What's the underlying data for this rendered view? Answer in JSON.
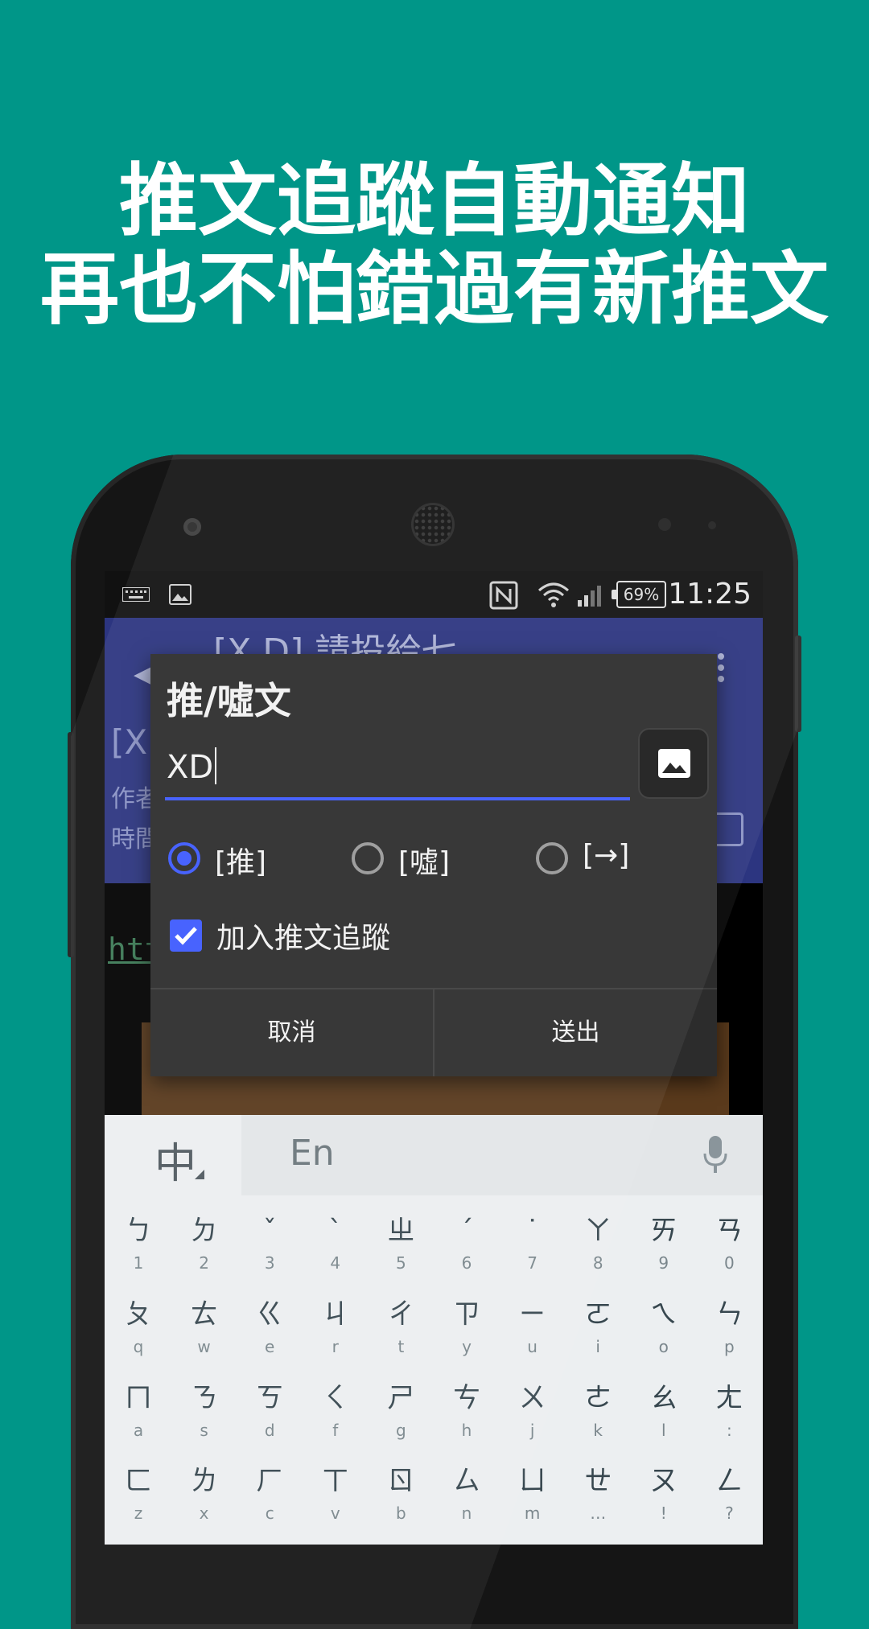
{
  "headline": {
    "line1": "推文追蹤自動通知",
    "line2": "再也不怕錯過有新推文"
  },
  "status_bar": {
    "battery": "69%",
    "time": "11:25",
    "icons": [
      "keyboard-icon",
      "image-icon",
      "nfc-icon",
      "wifi-icon",
      "signal-icon",
      "battery-icon"
    ]
  },
  "app_bar": {
    "title": "[X D] 請投給七"
  },
  "article": {
    "title_partial": "[X",
    "author_partial": "作者",
    "time_partial": "時間",
    "link_partial": "htt"
  },
  "dialog": {
    "title": "推/噓文",
    "input_value": "XD",
    "options": [
      {
        "label": "[推]",
        "selected": true
      },
      {
        "label": "[噓]",
        "selected": false
      },
      {
        "label": "[→]",
        "selected": false
      }
    ],
    "track_checkbox_label": "加入推文追蹤",
    "track_checked": true,
    "cancel_label": "取消",
    "send_label": "送出",
    "accent_color": "#3d5afe"
  },
  "keyboard": {
    "lang_label": "中",
    "en_label": "En",
    "rows": [
      [
        {
          "main": "ㄅ",
          "sub": "1"
        },
        {
          "main": "ㄉ",
          "sub": "2"
        },
        {
          "main": "ˇ",
          "sub": "3"
        },
        {
          "main": "ˋ",
          "sub": "4"
        },
        {
          "main": "ㄓ",
          "sub": "5"
        },
        {
          "main": "ˊ",
          "sub": "6"
        },
        {
          "main": "˙",
          "sub": "7"
        },
        {
          "main": "ㄚ",
          "sub": "8"
        },
        {
          "main": "ㄞ",
          "sub": "9"
        },
        {
          "main": "ㄢ",
          "sub": "0"
        }
      ],
      [
        {
          "main": "ㄆ",
          "sub": "q"
        },
        {
          "main": "ㄊ",
          "sub": "w"
        },
        {
          "main": "ㄍ",
          "sub": "e"
        },
        {
          "main": "ㄐ",
          "sub": "r"
        },
        {
          "main": "ㄔ",
          "sub": "t"
        },
        {
          "main": "ㄗ",
          "sub": "y"
        },
        {
          "main": "ㄧ",
          "sub": "u"
        },
        {
          "main": "ㄛ",
          "sub": "i"
        },
        {
          "main": "ㄟ",
          "sub": "o"
        },
        {
          "main": "ㄣ",
          "sub": "p"
        }
      ],
      [
        {
          "main": "ㄇ",
          "sub": "a"
        },
        {
          "main": "ㄋ",
          "sub": "s"
        },
        {
          "main": "ㄎ",
          "sub": "d"
        },
        {
          "main": "ㄑ",
          "sub": "f"
        },
        {
          "main": "ㄕ",
          "sub": "g"
        },
        {
          "main": "ㄘ",
          "sub": "h"
        },
        {
          "main": "ㄨ",
          "sub": "j"
        },
        {
          "main": "ㄜ",
          "sub": "k"
        },
        {
          "main": "ㄠ",
          "sub": "l"
        },
        {
          "main": "ㄤ",
          "sub": ":"
        }
      ],
      [
        {
          "main": "ㄈ",
          "sub": "z"
        },
        {
          "main": "ㄌ",
          "sub": "x"
        },
        {
          "main": "ㄏ",
          "sub": "c"
        },
        {
          "main": "ㄒ",
          "sub": "v"
        },
        {
          "main": "ㄖ",
          "sub": "b"
        },
        {
          "main": "ㄙ",
          "sub": "n"
        },
        {
          "main": "ㄩ",
          "sub": "m"
        },
        {
          "main": "ㄝ",
          "sub": "…"
        },
        {
          "main": "ㄡ",
          "sub": "!"
        },
        {
          "main": "ㄥ",
          "sub": "?"
        }
      ]
    ]
  }
}
